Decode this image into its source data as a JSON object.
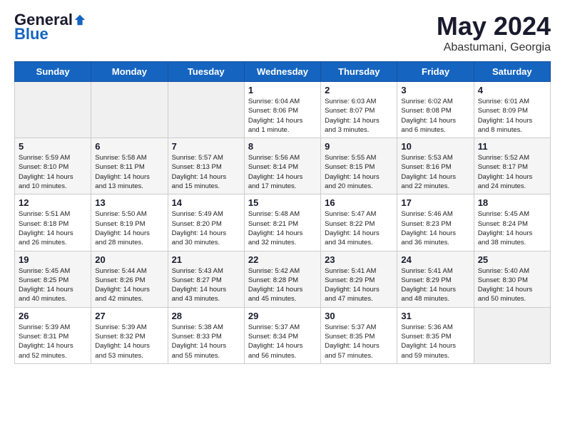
{
  "header": {
    "logo_general": "General",
    "logo_blue": "Blue",
    "title": "May 2024",
    "location": "Abastumani, Georgia"
  },
  "days_of_week": [
    "Sunday",
    "Monday",
    "Tuesday",
    "Wednesday",
    "Thursday",
    "Friday",
    "Saturday"
  ],
  "weeks": [
    [
      {
        "day": "",
        "info": ""
      },
      {
        "day": "",
        "info": ""
      },
      {
        "day": "",
        "info": ""
      },
      {
        "day": "1",
        "info": "Sunrise: 6:04 AM\nSunset: 8:06 PM\nDaylight: 14 hours\nand 1 minute."
      },
      {
        "day": "2",
        "info": "Sunrise: 6:03 AM\nSunset: 8:07 PM\nDaylight: 14 hours\nand 3 minutes."
      },
      {
        "day": "3",
        "info": "Sunrise: 6:02 AM\nSunset: 8:08 PM\nDaylight: 14 hours\nand 6 minutes."
      },
      {
        "day": "4",
        "info": "Sunrise: 6:01 AM\nSunset: 8:09 PM\nDaylight: 14 hours\nand 8 minutes."
      }
    ],
    [
      {
        "day": "5",
        "info": "Sunrise: 5:59 AM\nSunset: 8:10 PM\nDaylight: 14 hours\nand 10 minutes."
      },
      {
        "day": "6",
        "info": "Sunrise: 5:58 AM\nSunset: 8:11 PM\nDaylight: 14 hours\nand 13 minutes."
      },
      {
        "day": "7",
        "info": "Sunrise: 5:57 AM\nSunset: 8:13 PM\nDaylight: 14 hours\nand 15 minutes."
      },
      {
        "day": "8",
        "info": "Sunrise: 5:56 AM\nSunset: 8:14 PM\nDaylight: 14 hours\nand 17 minutes."
      },
      {
        "day": "9",
        "info": "Sunrise: 5:55 AM\nSunset: 8:15 PM\nDaylight: 14 hours\nand 20 minutes."
      },
      {
        "day": "10",
        "info": "Sunrise: 5:53 AM\nSunset: 8:16 PM\nDaylight: 14 hours\nand 22 minutes."
      },
      {
        "day": "11",
        "info": "Sunrise: 5:52 AM\nSunset: 8:17 PM\nDaylight: 14 hours\nand 24 minutes."
      }
    ],
    [
      {
        "day": "12",
        "info": "Sunrise: 5:51 AM\nSunset: 8:18 PM\nDaylight: 14 hours\nand 26 minutes."
      },
      {
        "day": "13",
        "info": "Sunrise: 5:50 AM\nSunset: 8:19 PM\nDaylight: 14 hours\nand 28 minutes."
      },
      {
        "day": "14",
        "info": "Sunrise: 5:49 AM\nSunset: 8:20 PM\nDaylight: 14 hours\nand 30 minutes."
      },
      {
        "day": "15",
        "info": "Sunrise: 5:48 AM\nSunset: 8:21 PM\nDaylight: 14 hours\nand 32 minutes."
      },
      {
        "day": "16",
        "info": "Sunrise: 5:47 AM\nSunset: 8:22 PM\nDaylight: 14 hours\nand 34 minutes."
      },
      {
        "day": "17",
        "info": "Sunrise: 5:46 AM\nSunset: 8:23 PM\nDaylight: 14 hours\nand 36 minutes."
      },
      {
        "day": "18",
        "info": "Sunrise: 5:45 AM\nSunset: 8:24 PM\nDaylight: 14 hours\nand 38 minutes."
      }
    ],
    [
      {
        "day": "19",
        "info": "Sunrise: 5:45 AM\nSunset: 8:25 PM\nDaylight: 14 hours\nand 40 minutes."
      },
      {
        "day": "20",
        "info": "Sunrise: 5:44 AM\nSunset: 8:26 PM\nDaylight: 14 hours\nand 42 minutes."
      },
      {
        "day": "21",
        "info": "Sunrise: 5:43 AM\nSunset: 8:27 PM\nDaylight: 14 hours\nand 43 minutes."
      },
      {
        "day": "22",
        "info": "Sunrise: 5:42 AM\nSunset: 8:28 PM\nDaylight: 14 hours\nand 45 minutes."
      },
      {
        "day": "23",
        "info": "Sunrise: 5:41 AM\nSunset: 8:29 PM\nDaylight: 14 hours\nand 47 minutes."
      },
      {
        "day": "24",
        "info": "Sunrise: 5:41 AM\nSunset: 8:29 PM\nDaylight: 14 hours\nand 48 minutes."
      },
      {
        "day": "25",
        "info": "Sunrise: 5:40 AM\nSunset: 8:30 PM\nDaylight: 14 hours\nand 50 minutes."
      }
    ],
    [
      {
        "day": "26",
        "info": "Sunrise: 5:39 AM\nSunset: 8:31 PM\nDaylight: 14 hours\nand 52 minutes."
      },
      {
        "day": "27",
        "info": "Sunrise: 5:39 AM\nSunset: 8:32 PM\nDaylight: 14 hours\nand 53 minutes."
      },
      {
        "day": "28",
        "info": "Sunrise: 5:38 AM\nSunset: 8:33 PM\nDaylight: 14 hours\nand 55 minutes."
      },
      {
        "day": "29",
        "info": "Sunrise: 5:37 AM\nSunset: 8:34 PM\nDaylight: 14 hours\nand 56 minutes."
      },
      {
        "day": "30",
        "info": "Sunrise: 5:37 AM\nSunset: 8:35 PM\nDaylight: 14 hours\nand 57 minutes."
      },
      {
        "day": "31",
        "info": "Sunrise: 5:36 AM\nSunset: 8:35 PM\nDaylight: 14 hours\nand 59 minutes."
      },
      {
        "day": "",
        "info": ""
      }
    ]
  ]
}
